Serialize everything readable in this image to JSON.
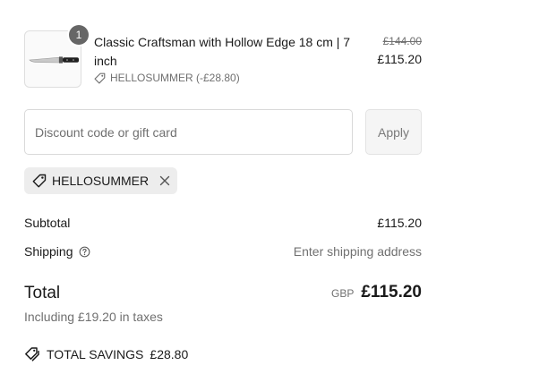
{
  "line_item": {
    "quantity": "1",
    "name": "Classic Craftsman with Hollow Edge 18 cm | 7 inch",
    "discount_text": "HELLOSUMMER (-£28.80)",
    "original_price": "£144.00",
    "price": "£115.20",
    "image_icon": "chef-knife-image"
  },
  "discount": {
    "placeholder": "Discount code or gift card",
    "value": "",
    "apply_label": "Apply",
    "applied_code": "HELLOSUMMER"
  },
  "summary": {
    "subtotal_label": "Subtotal",
    "subtotal_value": "£115.20",
    "shipping_label": "Shipping",
    "shipping_value": "Enter shipping address",
    "total_label": "Total",
    "currency": "GBP",
    "total_value": "£115.20",
    "taxes_text": "Including £19.20 in taxes",
    "savings_label": "TOTAL SAVINGS",
    "savings_value": "£28.80"
  },
  "colors": {
    "text": "#1a1a1a",
    "muted": "#707070",
    "chip_bg": "#ededed",
    "badge_bg": "#666666",
    "border": "#d9d9d9"
  }
}
